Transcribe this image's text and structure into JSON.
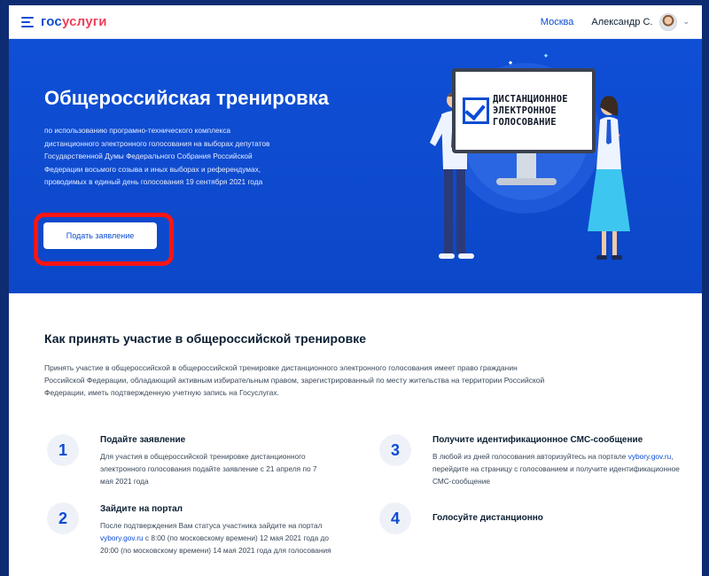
{
  "header": {
    "logo_part1": "гос",
    "logo_part2": "услуги",
    "city": "Москва",
    "user": "Александр С."
  },
  "hero": {
    "title": "Общероссийская тренировка",
    "description": "по использованию програмно-технического комплекса дистанционного электронного голосования на выборах депутатов Государственной Думы Федерального Собрания Российской Федерации восьмого созыва и иных выборах и референдумах, проводимых в единый день голосования 19 сентября 2021 года",
    "apply_button": "Подать заявление",
    "monitor_text_line1": "ДИСТАНЦИОННОЕ",
    "monitor_text_line2": "ЭЛЕКТРОННОЕ",
    "monitor_text_line3": "ГОЛОСОВАНИЕ"
  },
  "section": {
    "title": "Как принять участие в общероссийской тренировке",
    "description": "Принять участие в общероссийской в общероссийской тренировке дистанционного электронного голосования имеет право гражданин Российской Федерации, обладающий активным избирательным правом, зарегистрированный по месту жительства на территории Российской Федерации, иметь подтвержденную учетную запись на Госуслугах."
  },
  "steps": [
    {
      "number": "1",
      "title": "Подайте заявление",
      "text": "Для участия в общероссийской тренировке дистанционного электронного голосования подайте заявление с 21 апреля по 7 мая 2021 года"
    },
    {
      "number": "2",
      "title": "Зайдите на портал",
      "text_before_link": "После подтверждения Вам статуса участника зайдите на портал ",
      "link": "vybory.gov.ru",
      "text_after_link": " с 8:00 (по московскому времени) 12 мая 2021 года до 20:00 (по московскому времени) 14 мая 2021 года для голосования"
    },
    {
      "number": "3",
      "title": "Получите идентификационное СМС-сообщение",
      "text_before_link": "В любой из дней голосования авторизуйтесь на портале ",
      "link": "vybory.gov.ru",
      "text_after_link": ", перейдите на страницу с голосованием и получите идентификационное СМС-сообщение"
    },
    {
      "number": "4",
      "title": "Голосуйте дистанционно"
    }
  ],
  "colors": {
    "brand_blue": "#0d4cd3",
    "brand_red": "#ee3f58",
    "hero_bg": "#0f4fd6",
    "highlight_red": "#ff1414"
  }
}
